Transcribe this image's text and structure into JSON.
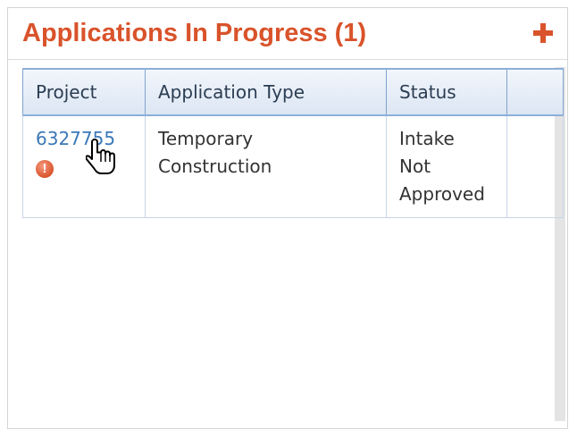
{
  "panel": {
    "title": "Applications In Progress (1)",
    "add_icon": "plus-icon"
  },
  "table": {
    "columns": [
      "Project",
      "Application Type",
      "Status",
      ""
    ],
    "rows": [
      {
        "project": "6327755",
        "project_status_icon": "warning-icon",
        "warning_glyph": "!",
        "application_type": [
          "Temporary",
          "Construction"
        ],
        "status": [
          "Intake",
          "Not",
          "Approved"
        ],
        "extra": ""
      }
    ]
  },
  "cursor_icon": "hand-pointer-icon",
  "colors": {
    "title": "#d9532b",
    "link": "#3a78b8",
    "header_bg": "#dce6f3",
    "header_border": "#7fa3cf"
  }
}
